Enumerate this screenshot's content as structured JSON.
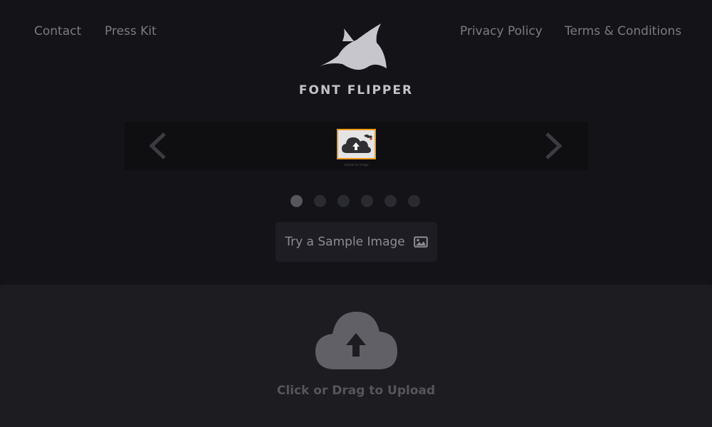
{
  "nav": {
    "contact": "Contact",
    "press_kit": "Press Kit",
    "privacy": "Privacy Policy",
    "terms": "Terms & Conditions"
  },
  "brand": {
    "name": "FONT FLIPPER",
    "logo_icon": "shark-icon"
  },
  "carousel": {
    "prev_icon": "chevron-left-icon",
    "next_icon": "chevron-right-icon",
    "thumb_caption": "Upload an Image",
    "thumb_border_color": "#f09a1a",
    "total_slides": 6,
    "active_slide": 1
  },
  "sample_button": {
    "label": "Try a Sample Image",
    "icon": "image-icon"
  },
  "upload": {
    "label": "Click or Drag to Upload",
    "icon": "cloud-upload-icon"
  }
}
